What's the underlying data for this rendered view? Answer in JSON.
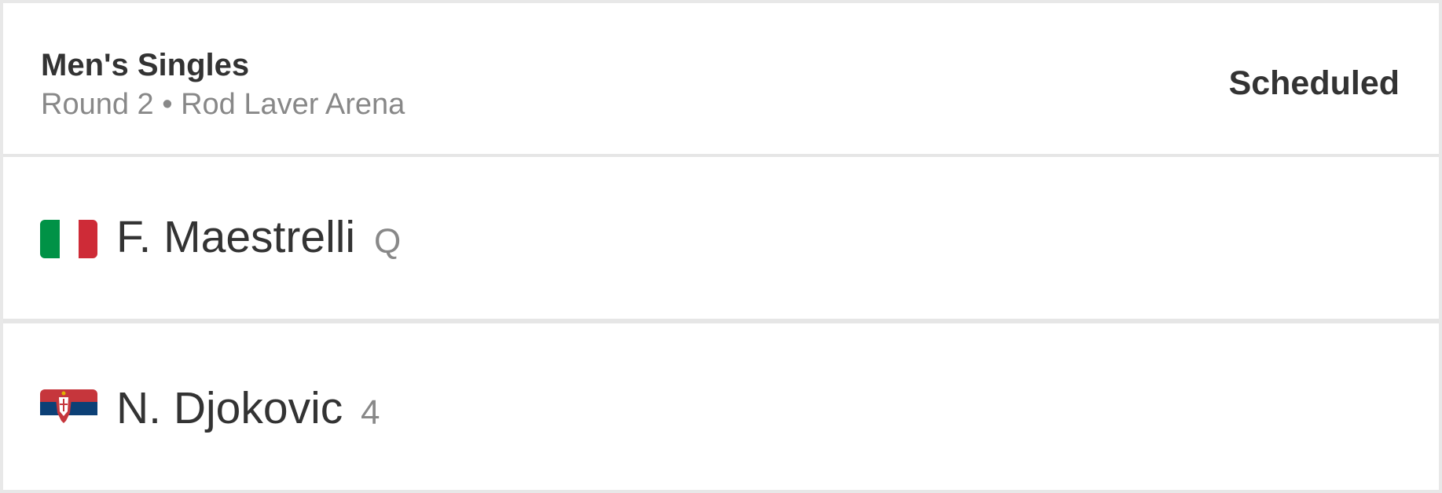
{
  "match": {
    "event": "Men's Singles",
    "details": "Round 2 • Rod Laver Arena",
    "status": "Scheduled"
  },
  "players": [
    {
      "name": "F. Maestrelli",
      "seed": "Q",
      "flag_icon": "italy-flag-icon",
      "flag_colors": [
        "#009246",
        "#ffffff",
        "#ce2b37"
      ]
    },
    {
      "name": "N. Djokovic",
      "seed": "4",
      "flag_icon": "serbia-flag-icon",
      "flag_colors": [
        "#c6363c",
        "#0c4076",
        "#ffffff"
      ]
    }
  ],
  "colors": {
    "text_primary": "#333333",
    "text_secondary": "#888888",
    "divider": "#e6e6e6",
    "background": "#ffffff"
  }
}
